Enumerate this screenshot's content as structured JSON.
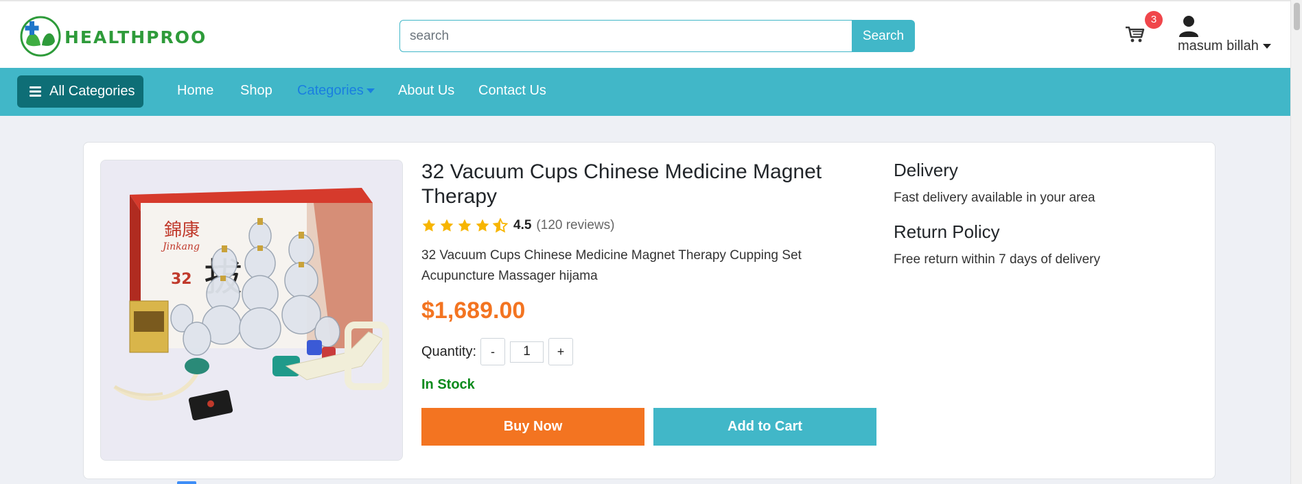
{
  "header": {
    "logo_text": "HEALTHPROO",
    "search_placeholder": "search",
    "search_button": "Search",
    "cart_count": "3",
    "user_name": "masum billah"
  },
  "nav": {
    "all_categories": "All Categories",
    "links": [
      "Home",
      "Shop",
      "Categories",
      "About Us",
      "Contact Us"
    ]
  },
  "product": {
    "title": "32 Vacuum Cups Chinese Medicine Magnet Therapy",
    "rating": "4.5",
    "rating_stars": 4.5,
    "reviews": "(120 reviews)",
    "description": "32 Vacuum Cups Chinese Medicine Magnet Therapy Cupping Set Acupuncture Massager hijama",
    "price": "$1,689.00",
    "quantity_label": "Quantity:",
    "quantity_minus": "-",
    "quantity_value": "1",
    "quantity_plus": "+",
    "stock": "In Stock",
    "buy_now": "Buy Now",
    "add_to_cart": "Add to Cart",
    "box_brand": "Jinkang",
    "box_label": "32"
  },
  "sidebar": {
    "delivery_title": "Delivery",
    "delivery_text": "Fast delivery available in your area",
    "return_title": "Return Policy",
    "return_text": "Free return within 7 days of delivery"
  },
  "colors": {
    "primary": "#41b7c8",
    "dark_teal": "#0e6e76",
    "price": "#f37421",
    "stock": "#0b8a1c",
    "active_link": "#1a7ee0",
    "badge": "#f0464b"
  }
}
